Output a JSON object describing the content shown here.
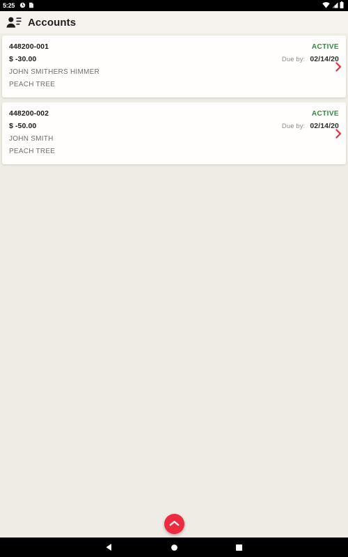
{
  "statusbar": {
    "time": "5:25",
    "left_icons": [
      "clock-notification-icon",
      "sim-notification-icon"
    ],
    "right_icons": [
      "wifi-icon",
      "signal-icon",
      "battery-icon"
    ]
  },
  "toolbar": {
    "icon": "accounts-people-icon",
    "title": "Accounts"
  },
  "accounts": [
    {
      "number": "448200-001",
      "amount": "$ -30.00",
      "name": "JOHN SMITHERS HIMMER",
      "branch": "PEACH TREE",
      "status": "ACTIVE",
      "due_label": "Due by:",
      "due_date": "02/14/20",
      "chevron": "chevron-right-icon"
    },
    {
      "number": "448200-002",
      "amount": "$ -50.00",
      "name": "JOHN SMITH",
      "branch": "PEACH TREE",
      "status": "ACTIVE",
      "due_label": "Due by:",
      "due_date": "02/14/20",
      "chevron": "chevron-right-icon"
    }
  ],
  "fab": {
    "icon": "chevron-up-icon",
    "color": "#ee2a41"
  },
  "navbar": {
    "back": "back-triangle-icon",
    "home": "home-circle-icon",
    "recents": "recents-square-icon"
  },
  "colors": {
    "status_active": "#2f8b3c",
    "accent": "#ee2a41",
    "page_background": "#efebe5",
    "card_background": "#fffefc",
    "toolbar_background": "#f6f3ef"
  }
}
